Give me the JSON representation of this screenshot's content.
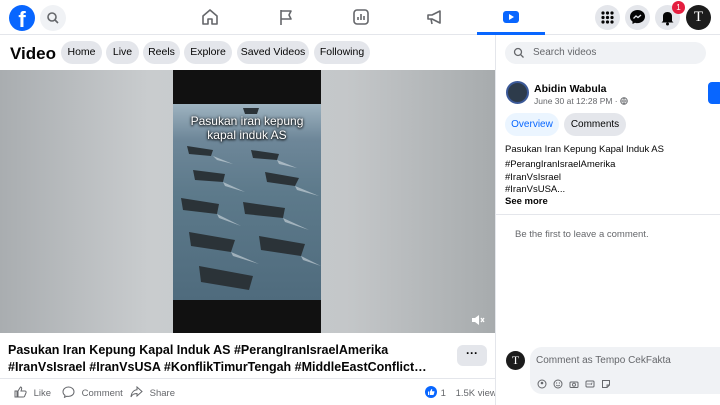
{
  "topnav": {
    "notification_count": "1",
    "avatar_letter": "T"
  },
  "subnav": {
    "title": "Video",
    "pills": [
      "Home",
      "Live",
      "Reels",
      "Explore",
      "Saved Videos",
      "Following"
    ]
  },
  "video": {
    "overlay_line1": "Pasukan iran kepung",
    "overlay_line2": "kapal induk AS",
    "title_line1": "Pasukan Iran Kepung Kapal Induk AS #PerangIranIsraelAmerika",
    "title_line2": "#IranVsIsrael #IranVsUSA #KonflikTimurTengah #MiddleEastConflict…",
    "more_label": "···",
    "like_label": "Like",
    "comment_label": "Comment",
    "share_label": "Share",
    "reaction_count": "1",
    "views": "1.5K views"
  },
  "right": {
    "search_placeholder": "Search videos",
    "author": "Abidin Wabula",
    "date": "June 30 at 12:28 PM · ",
    "tab_overview": "Overview",
    "tab_comments": "Comments",
    "description": "Pasukan Iran Kepung Kapal Induk AS",
    "hashtag1": "#PerangIranIsraelAmerika",
    "hashtag2": "#IranVsIsrael",
    "hashtag3": "#IranVsUSA...",
    "see_more": "See more",
    "no_comments": "Be the first to leave a comment.",
    "comment_placeholder": "Comment as Tempo CekFakta",
    "commenter_letter": "T"
  },
  "colors": {
    "brand": "#0866ff",
    "badge": "#e41e3f",
    "pill_bg": "#e4e6eb",
    "muted_text": "#65676b"
  },
  "icons": [
    "facebook-logo",
    "search-icon",
    "home-icon",
    "flag-icon",
    "marketplace-icon",
    "megaphone-icon",
    "video-icon",
    "menu-grid-icon",
    "messenger-icon",
    "bell-icon",
    "mute-icon",
    "like-icon",
    "comment-icon",
    "share-icon",
    "globe-icon"
  ]
}
